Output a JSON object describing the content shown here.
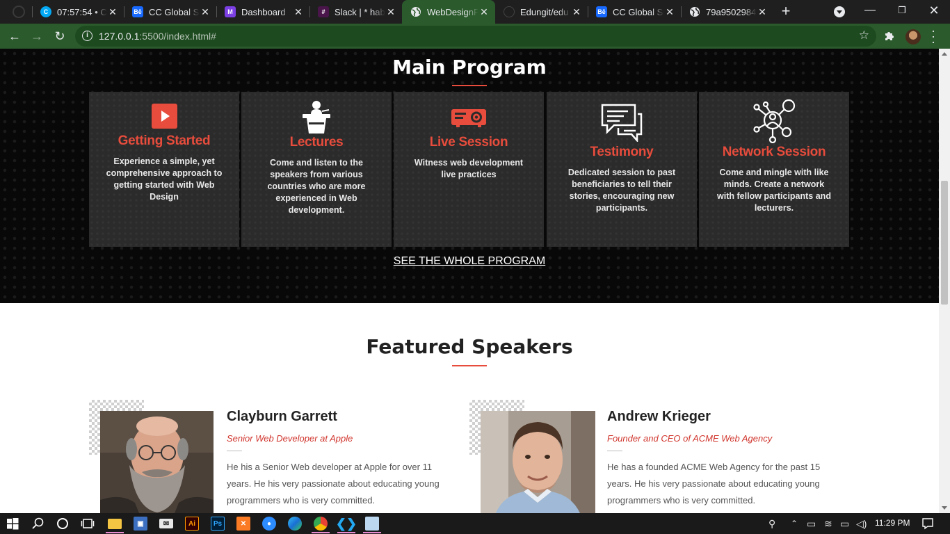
{
  "browser": {
    "tabs": [
      {
        "title": "07:57:54 • Cl",
        "favicon": "clockify-icon",
        "color": "#03a9f4",
        "active": false
      },
      {
        "title": "CC Global Su",
        "favicon": "behance-icon",
        "color": "#1769ff",
        "active": false
      },
      {
        "title": "Dashboard",
        "favicon": "dashboard-app-icon",
        "color": "#7b3fe4",
        "active": false
      },
      {
        "title": "Slack | * habe",
        "favicon": "slack-icon",
        "color": "#4a154b",
        "active": false
      },
      {
        "title": "WebDesignP",
        "favicon": "globe-icon",
        "color": "#e8eaed",
        "active": true
      },
      {
        "title": "Edungit/edu",
        "favicon": "github-icon",
        "color": "#333333",
        "active": false
      },
      {
        "title": "CC Global Su",
        "favicon": "behance-icon",
        "color": "#1769ff",
        "active": false
      },
      {
        "title": "79a9502984",
        "favicon": "globe-icon",
        "color": "#e8eaed",
        "active": false
      }
    ],
    "new_tab_label": "+",
    "url_host": "127.0.0.1",
    "url_rest": ":5500/index.html#",
    "accent": "#2b5a2c"
  },
  "program": {
    "title": "Main Program",
    "cards": [
      {
        "title": "Getting Started",
        "desc": "Experience a simple, yet comprehensive approach to getting started with Web Design",
        "icon": "play-icon"
      },
      {
        "title": "Lectures",
        "desc": "Come and listen to the speakers from various countries who are more experienced in Web development.",
        "icon": "lectern-icon"
      },
      {
        "title": "Live Session",
        "desc": "Witness web development live practices",
        "icon": "projector-icon"
      },
      {
        "title": "Testimony",
        "desc": "Dedicated session to past beneficiaries to tell their stories, encouraging new participants.",
        "icon": "chat-bubbles-icon"
      },
      {
        "title": "Network Session",
        "desc": "Come and mingle with like minds. Create a network with fellow participants and lecturers.",
        "icon": "network-icon"
      }
    ],
    "see_all": "SEE THE WHOLE PROGRAM",
    "accent": "#e74c3c"
  },
  "speakers": {
    "title": "Featured Speakers",
    "list": [
      {
        "name": "Clayburn Garrett",
        "role": "Senior Web Developer at Apple",
        "bio": "He his a Senior Web developer at Apple for over 11 years. He his very passionate about educating young programmers who is very committed."
      },
      {
        "name": "Andrew Krieger",
        "role": "Founder and CEO of ACME Web Agency",
        "bio": "He has a founded ACME Web Agency for the past 15 years. He his very passionate about educating young programmers who is very committed."
      }
    ]
  },
  "taskbar": {
    "apps": [
      "file-explorer-icon",
      "store-icon",
      "mail-icon",
      "illustrator-icon",
      "photoshop-icon",
      "xampp-icon",
      "zoom-icon",
      "edge-icon",
      "chrome-icon",
      "vscode-icon",
      "notepad-icon"
    ],
    "illustrator_label": "Ai",
    "photoshop_label": "Ps",
    "time": "11:29 PM"
  }
}
